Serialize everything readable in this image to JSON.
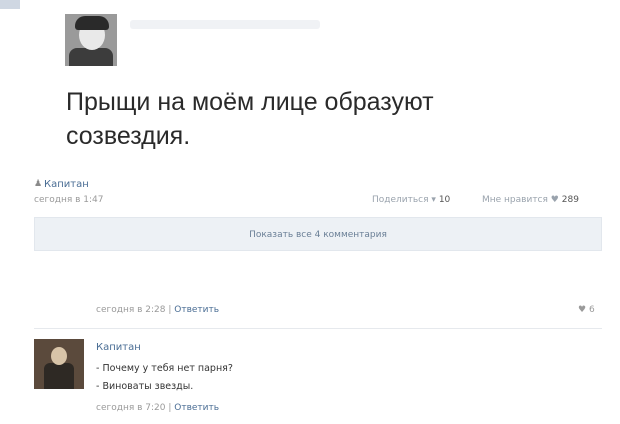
{
  "post": {
    "text_line1": "Прыщи на моём лице образуют",
    "text_line2": "созвездия.",
    "author": "Капитан",
    "time": "сегодня в 1:47",
    "share_label": "Поделиться",
    "share_count": "10",
    "like_label": "Мне нравится",
    "like_count": "289"
  },
  "comments_bar": {
    "show_all_label": "Показать все 4 комментария"
  },
  "comment1": {
    "time": "сегодня в 2:28",
    "reply_label": "Ответить",
    "likes": "6"
  },
  "comment2": {
    "author": "Капитан",
    "line1": "- Почему у тебя нет парня?",
    "line2": "- Виноваты звезды.",
    "time": "сегодня в 7:20",
    "reply_label": "Ответить"
  },
  "icons": {
    "author_icon": "person-icon",
    "share_icon": "megaphone-icon",
    "like_icon": "heart-icon"
  }
}
